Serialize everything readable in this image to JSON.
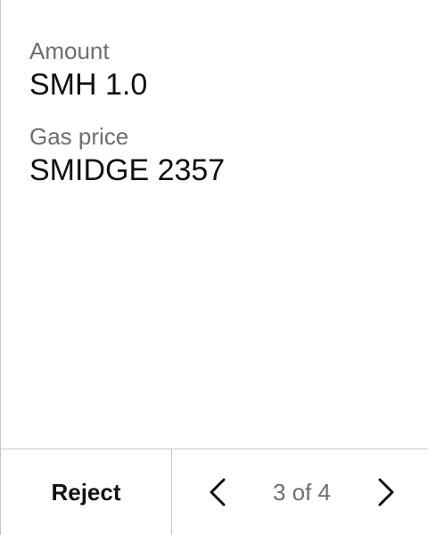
{
  "details": {
    "amount_label": "Amount",
    "amount_value": "SMH 1.0",
    "gas_label": "Gas price",
    "gas_value": "SMIDGE 2357"
  },
  "footer": {
    "reject_label": "Reject",
    "page_indicator": "3 of 4",
    "prev_icon": "chevron-left-icon",
    "next_icon": "chevron-right-icon"
  }
}
